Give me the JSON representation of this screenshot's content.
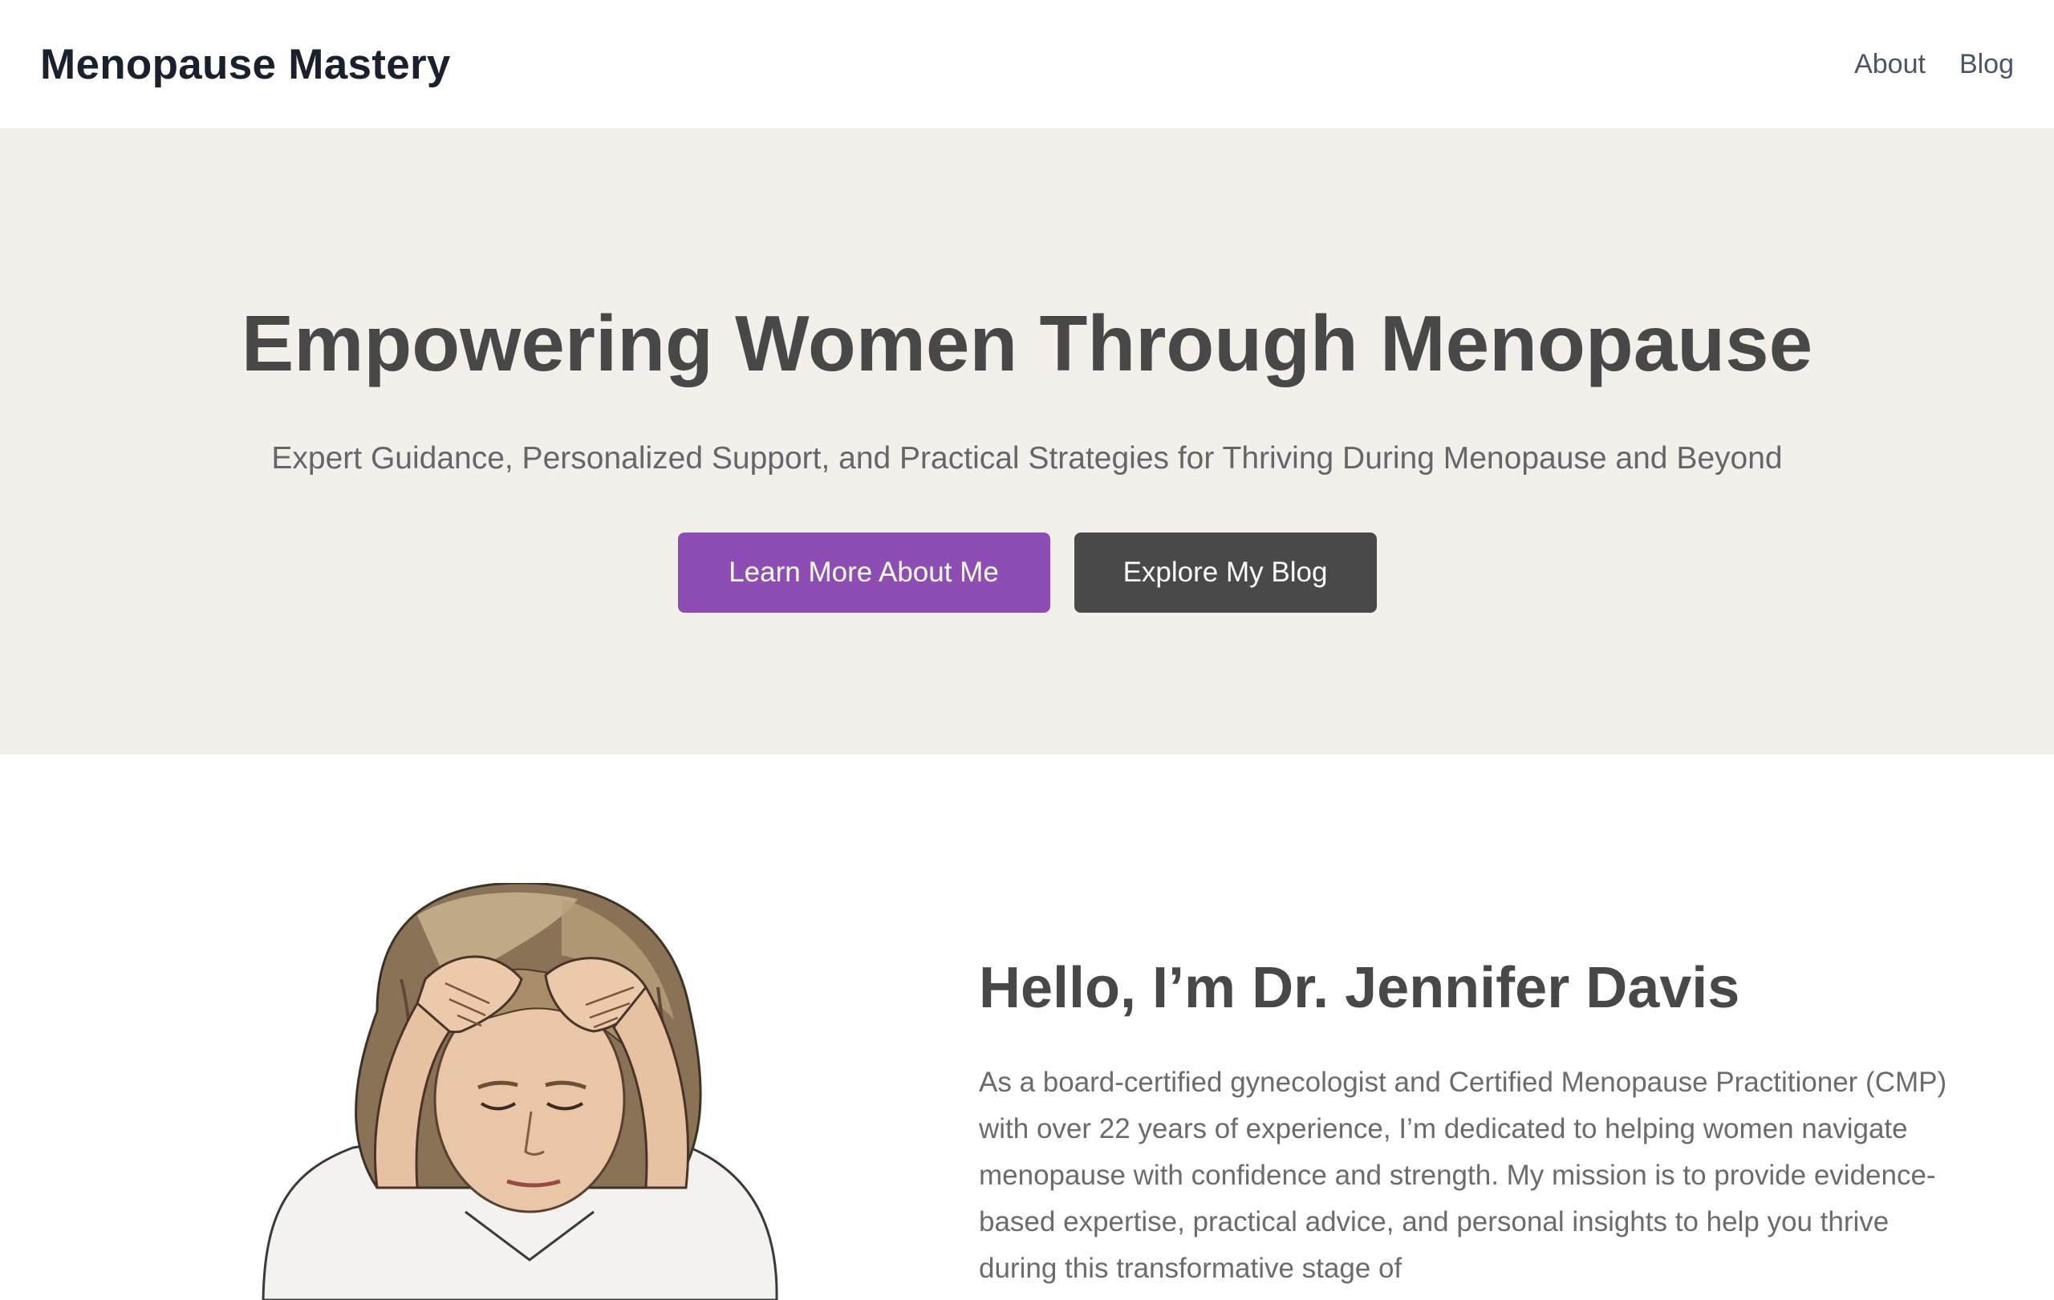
{
  "header": {
    "brand": "Menopause Mastery",
    "nav": [
      {
        "label": "About"
      },
      {
        "label": "Blog"
      }
    ]
  },
  "hero": {
    "title": "Empowering Women Through Menopause",
    "subtitle": "Expert Guidance, Personalized Support, and Practical Strategies for Thriving During Menopause and Beyond",
    "primary_button": "Learn More About Me",
    "secondary_button": "Explore My Blog"
  },
  "about": {
    "heading": "Hello, I’m Dr. Jennifer Davis",
    "bio": "As a board-certified gynecologist and Certified Menopause Practitioner (CMP) with over 22 years of experience, I’m dedicated to helping women navigate menopause with confidence and strength. My mission is to provide evidence-based expertise, practical advice, and personal insights to help you thrive during this transformative stage of"
  },
  "colors": {
    "accent": "#8e4db3",
    "dark_button": "#494949",
    "hero_background": "#f3f0ec",
    "heading_text": "#484848"
  }
}
